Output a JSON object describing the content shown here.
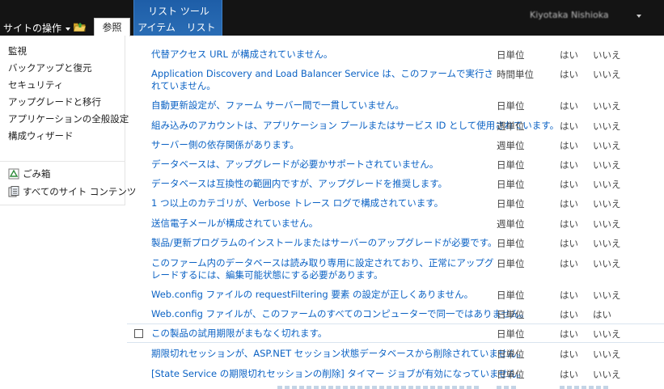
{
  "ribbon": {
    "site_actions": "サイトの操作",
    "tab_browse": "参照",
    "list_tools": {
      "title": "リスト ツール",
      "tabs": [
        "アイテム",
        "リスト"
      ]
    },
    "user_name": "Kiyotaka Nishioka"
  },
  "left_menu": {
    "items": [
      "監視",
      "バックアップと復元",
      "セキュリティ",
      "アップグレードと移行",
      "アプリケーションの全般設定",
      "構成ウィザード"
    ],
    "recycle_bin": "ごみ箱",
    "all_site_content": "すべてのサイト コンテンツ"
  },
  "rules": [
    {
      "title": "代替アクセス URL が構成されていません。",
      "schedule": "日単位",
      "col_c": "はい",
      "col_d": "いいえ"
    },
    {
      "title": "Application Discovery and Load Balancer Service は、このファームで実行されていません。",
      "schedule": "時間単位",
      "col_c": "はい",
      "col_d": "いいえ"
    },
    {
      "title": "自動更新設定が、ファーム サーバー間で一貫していません。",
      "schedule": "日単位",
      "col_c": "はい",
      "col_d": "いいえ"
    },
    {
      "title": "組み込みのアカウントは、アプリケーション プールまたはサービス ID として使用されています。",
      "schedule": "週単位",
      "col_c": "はい",
      "col_d": "いいえ"
    },
    {
      "title": "サーバー側の依存関係があります。",
      "schedule": "週単位",
      "col_c": "はい",
      "col_d": "いいえ"
    },
    {
      "title": "データベースは、アップグレードが必要かサポートされていません。",
      "schedule": "日単位",
      "col_c": "はい",
      "col_d": "いいえ"
    },
    {
      "title": "データベースは互換性の範囲内ですが、アップグレードを推奨します。",
      "schedule": "日単位",
      "col_c": "はい",
      "col_d": "いいえ"
    },
    {
      "title": "1 つ以上のカテゴリが、Verbose トレース ログで構成されています。",
      "schedule": "日単位",
      "col_c": "はい",
      "col_d": "いいえ"
    },
    {
      "title": "送信電子メールが構成されていません。",
      "schedule": "週単位",
      "col_c": "はい",
      "col_d": "いいえ"
    },
    {
      "title": "製品/更新プログラムのインストールまたはサーバーのアップグレードが必要です。",
      "schedule": "日単位",
      "col_c": "はい",
      "col_d": "いいえ"
    },
    {
      "title": "このファーム内のデータベースは読み取り専用に設定されており、正常にアップグレードするには、編集可能状態にする必要があります。",
      "schedule": "日単位",
      "col_c": "はい",
      "col_d": "いいえ"
    },
    {
      "title": "Web.config ファイルの requestFiltering 要素 の設定が正しくありません。",
      "schedule": "日単位",
      "col_c": "はい",
      "col_d": "いいえ"
    },
    {
      "title": "Web.config ファイルが、このファームのすべてのコンピューターで同一ではありません。",
      "schedule": "日単位",
      "col_c": "はい",
      "col_d": "はい"
    },
    {
      "title": "この製品の試用期限がまもなく切れます。",
      "schedule": "日単位",
      "col_c": "はい",
      "col_d": "いいえ"
    },
    {
      "title": "期限切れセッションが、ASP.NET セッション状態データベースから削除されていません。",
      "schedule": "日単位",
      "col_c": "はい",
      "col_d": "いいえ"
    },
    {
      "title": "[State Service の期限切れセッションの削除] タイマー ジョブが有効になっていません。",
      "schedule": "日単位",
      "col_c": "はい",
      "col_d": "いいえ"
    }
  ]
}
